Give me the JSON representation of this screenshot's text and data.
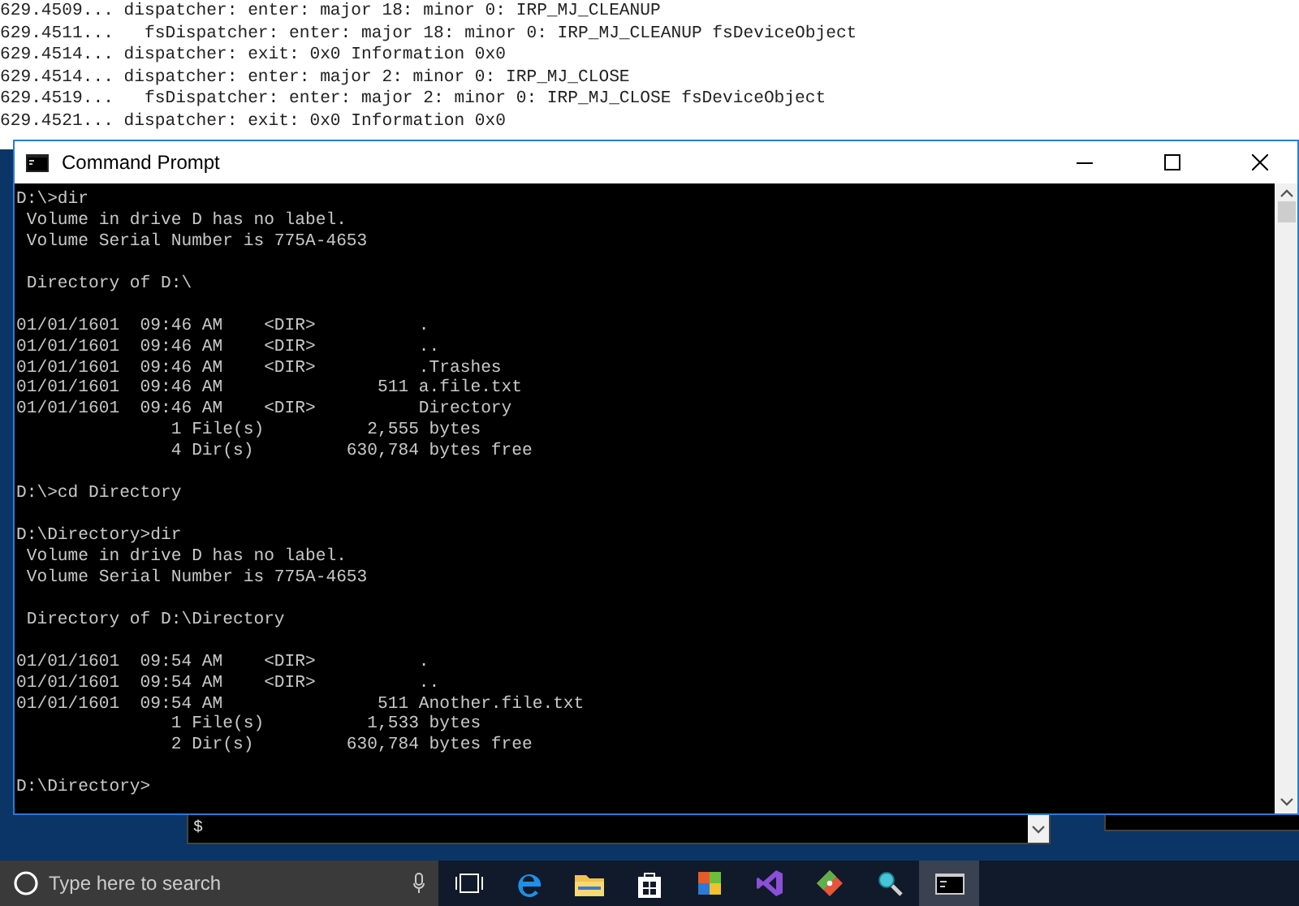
{
  "log_window": {
    "lines": [
      "629.4509... dispatcher: enter: major 18: minor 0: IRP_MJ_CLEANUP",
      "629.4511...   fsDispatcher: enter: major 18: minor 0: IRP_MJ_CLEANUP fsDeviceObject",
      "629.4514... dispatcher: exit: 0x0 Information 0x0",
      "629.4514... dispatcher: enter: major 2: minor 0: IRP_MJ_CLOSE",
      "629.4519...   fsDispatcher: enter: major 2: minor 0: IRP_MJ_CLOSE fsDeviceObject",
      "629.4521... dispatcher: exit: 0x0 Information 0x0"
    ]
  },
  "console": {
    "title": "Command Prompt",
    "blocks": [
      [
        "D:\\>dir",
        " Volume in drive D has no label.",
        " Volume Serial Number is 775A-4653"
      ],
      [
        " Directory of D:\\"
      ],
      [
        "01/01/1601  09:46 AM    <DIR>          .",
        "01/01/1601  09:46 AM    <DIR>          ..",
        "01/01/1601  09:46 AM    <DIR>          .Trashes",
        "01/01/1601  09:46 AM               511 a.file.txt",
        "01/01/1601  09:46 AM    <DIR>          Directory",
        "               1 File(s)          2,555 bytes",
        "               4 Dir(s)         630,784 bytes free"
      ],
      [
        "D:\\>cd Directory"
      ],
      [
        "D:\\Directory>dir",
        " Volume in drive D has no label.",
        " Volume Serial Number is 775A-4653"
      ],
      [
        " Directory of D:\\Directory"
      ],
      [
        "01/01/1601  09:54 AM    <DIR>          .",
        "01/01/1601  09:54 AM    <DIR>          ..",
        "01/01/1601  09:54 AM               511 Another.file.txt",
        "               1 File(s)          1,533 bytes",
        "               2 Dir(s)         630,784 bytes free"
      ],
      [
        "D:\\Directory>"
      ]
    ]
  },
  "background_terminal": {
    "prompt": "$"
  },
  "taskbar": {
    "search": {
      "placeholder": "Type here to search"
    }
  }
}
